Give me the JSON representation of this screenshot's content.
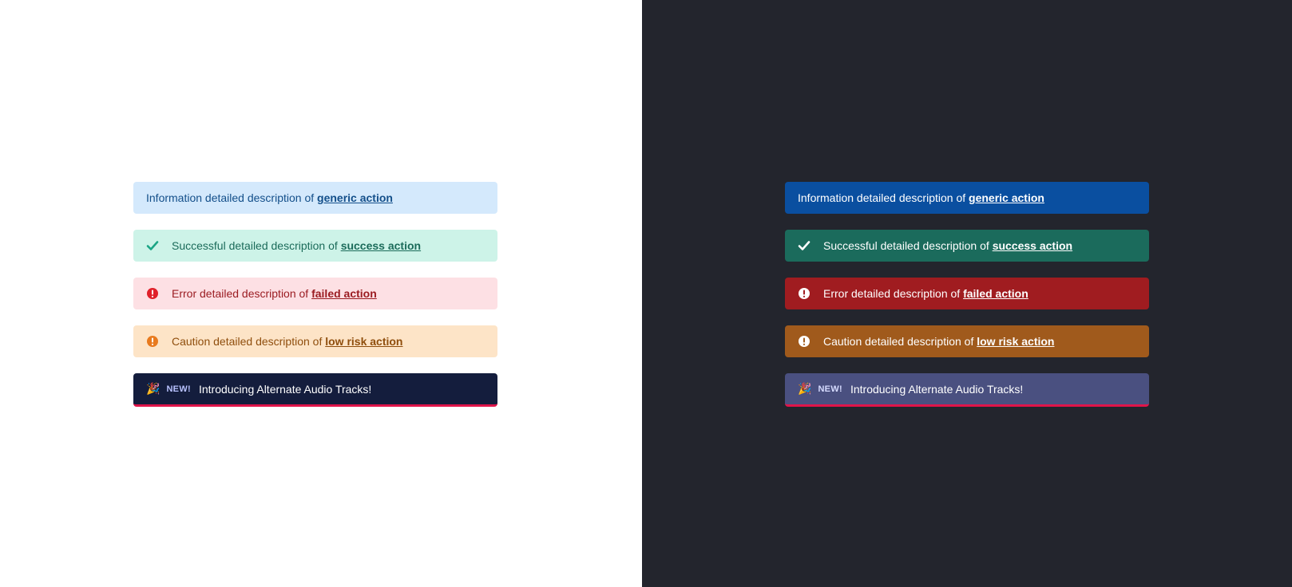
{
  "colors": {
    "light_bg": "#ffffff",
    "dark_bg": "#23252d",
    "info_light": "#d4e9fc",
    "success_light": "#cdf3e8",
    "error_light": "#fde0e4",
    "caution_light": "#fde4c7",
    "new_light": "#141d3d",
    "info_dark": "#0a4fa0",
    "success_dark": "#1b6b5c",
    "error_dark": "#a01c20",
    "caution_dark": "#a05a1c",
    "new_dark": "#4a5080",
    "new_accent": "#e0144a"
  },
  "banners": {
    "info": {
      "text": "Information detailed description of ",
      "link": "generic action"
    },
    "success": {
      "icon": "checkmark-icon",
      "text": "Successful detailed description of ",
      "link": "success action"
    },
    "error": {
      "icon": "exclamation-circle-icon",
      "text": "Error detailed description of ",
      "link": "failed action"
    },
    "caution": {
      "icon": "exclamation-circle-icon",
      "text": "Caution detailed description of ",
      "link": "low risk action"
    },
    "announcement": {
      "icon": "party-popper-icon",
      "tag": "NEW!",
      "text": "Introducing Alternate Audio Tracks!"
    }
  }
}
